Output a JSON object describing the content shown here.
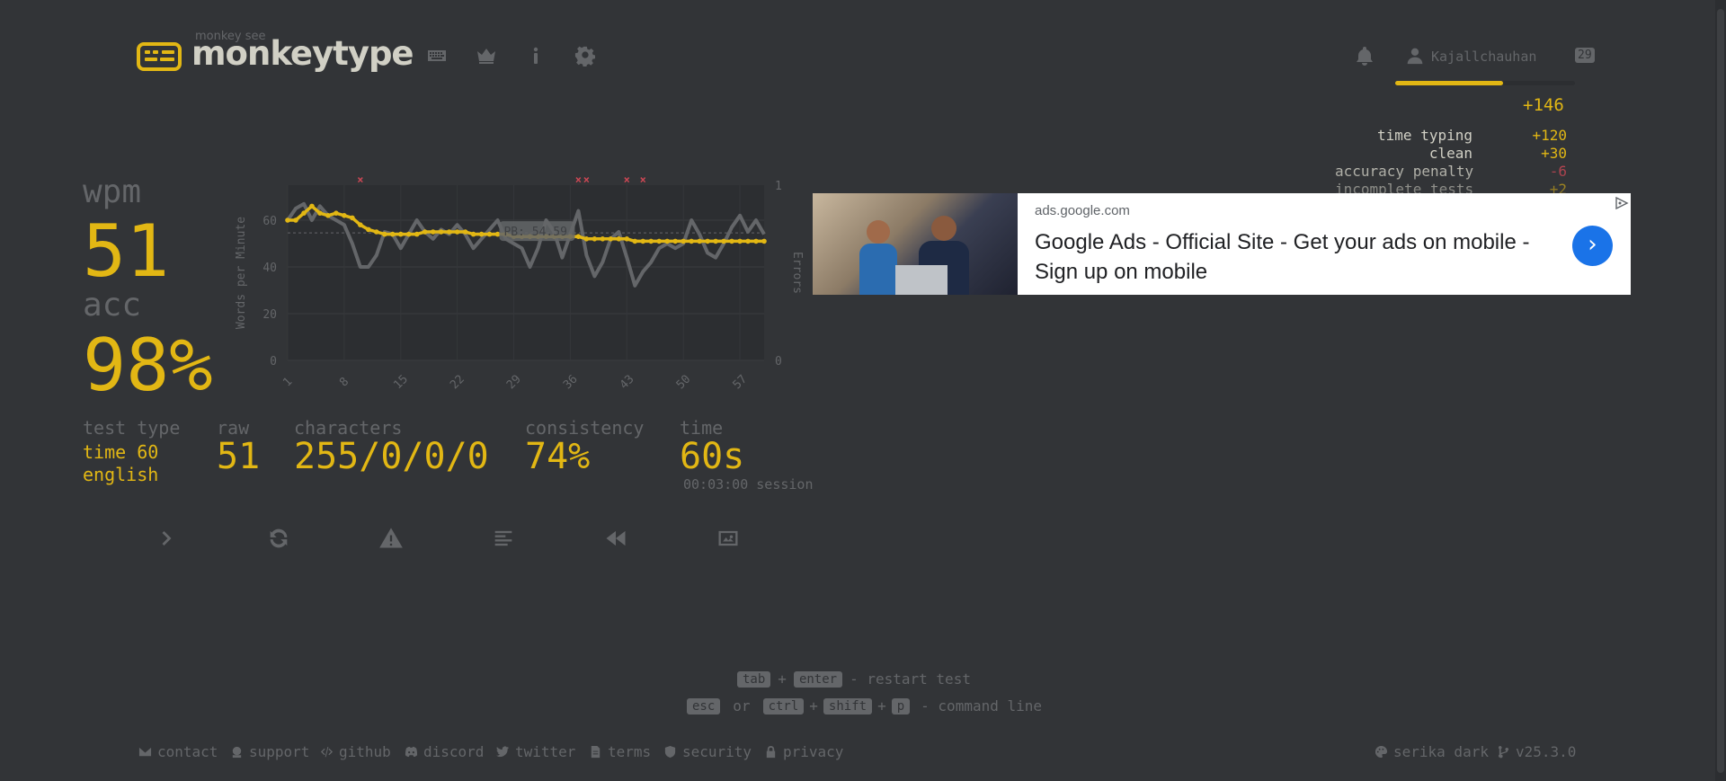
{
  "header": {
    "logo_small": "monkey see",
    "logo_text": "monkeytype",
    "nav": [
      "keyboard-icon",
      "crown-icon",
      "info-icon",
      "gear-icon"
    ],
    "user_name": "Kajallchauhan",
    "user_level": "29",
    "xp_progress": 0.6
  },
  "xp_breakdown": {
    "total": "+146",
    "rows": [
      {
        "label": "time typing",
        "value": "+120"
      },
      {
        "label": "clean",
        "value": "+30"
      },
      {
        "label": "accuracy penalty",
        "value": "-6"
      },
      {
        "label": "incomplete tests",
        "value": "+2"
      }
    ]
  },
  "results": {
    "wpm_label": "wpm",
    "wpm": "51",
    "acc_label": "acc",
    "acc": "98%",
    "test_type_label": "test type",
    "test_type_line1": "time 60",
    "test_type_line2": "english",
    "raw_label": "raw",
    "raw": "51",
    "characters_label": "characters",
    "characters": "255/0/0/0",
    "consistency_label": "consistency",
    "consistency": "74%",
    "time_label": "time",
    "time": "60s",
    "session": "00:03:00 session"
  },
  "chart_data": {
    "type": "line",
    "xlabel": "",
    "ylabel": "Words per Minute",
    "y2label": "Errors",
    "x_ticks": [
      "1",
      "8",
      "15",
      "22",
      "29",
      "36",
      "43",
      "50",
      "57"
    ],
    "y_ticks": [
      "0",
      "20",
      "40",
      "60"
    ],
    "y2_ticks": [
      "0",
      "1"
    ],
    "ylim": [
      0,
      75
    ],
    "pb_label": "PB: 54.59",
    "pb_value": 54.59,
    "series": [
      {
        "name": "wpm",
        "color": "#e2b714",
        "values": [
          60,
          60,
          63,
          66,
          63,
          62,
          63,
          62,
          61,
          58,
          56,
          55,
          54,
          54,
          54,
          54,
          54,
          55,
          55,
          55,
          55,
          55,
          55,
          54,
          54,
          54,
          54,
          54,
          53,
          53,
          53,
          53,
          53,
          53,
          53,
          53,
          53,
          52,
          52,
          52,
          52,
          52,
          52,
          51,
          51,
          51,
          51,
          51,
          51,
          51,
          51,
          51,
          51,
          51,
          51,
          51,
          51,
          51,
          51,
          51
        ]
      },
      {
        "name": "raw",
        "color": "#646669",
        "values": [
          60,
          65,
          67,
          60,
          66,
          62,
          60,
          58,
          50,
          40,
          40,
          45,
          55,
          54,
          48,
          54,
          60,
          55,
          52,
          56,
          54,
          58,
          54,
          48,
          52,
          56,
          60,
          52,
          50,
          48,
          40,
          48,
          60,
          55,
          44,
          54,
          64,
          45,
          36,
          42,
          52,
          55,
          44,
          32,
          38,
          42,
          48,
          50,
          48,
          50,
          60,
          54,
          46,
          44,
          50,
          57,
          62,
          55,
          60,
          54
        ]
      }
    ],
    "error_markers_x": [
      10,
      37,
      38,
      43,
      45
    ]
  },
  "actions": [
    "next-test",
    "restart-test",
    "report",
    "words-history",
    "replay",
    "screenshot"
  ],
  "ad": {
    "domain": "ads.google.com",
    "title": "Google Ads - Official Site - Get your ads on mobile - Sign up on mobile",
    "arrow": "›"
  },
  "shortcuts": {
    "tab": "tab",
    "plus": "+",
    "enter": "enter",
    "restart": "- restart test",
    "esc": "esc",
    "or": "or",
    "ctrl": "ctrl",
    "shift": "shift",
    "p": "p",
    "command": "- command line"
  },
  "footer": {
    "contact": "contact",
    "support": "support",
    "github": "github",
    "discord": "discord",
    "twitter": "twitter",
    "terms": "terms",
    "security": "security",
    "privacy": "privacy",
    "theme": "serika dark",
    "version": "v25.3.0"
  },
  "colors": {
    "bg": "#323437",
    "main": "#e2b714",
    "sub": "#646669",
    "text": "#d1d0c5",
    "error": "#ca4754"
  }
}
